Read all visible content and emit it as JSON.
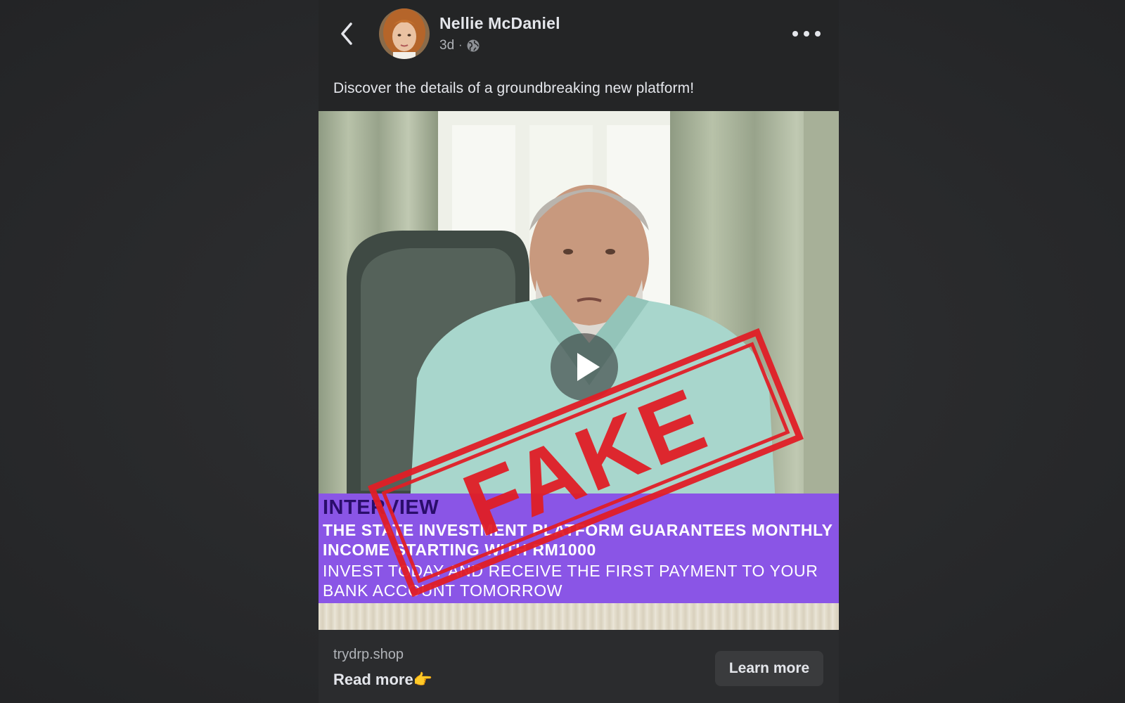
{
  "post": {
    "author_name": "Nellie McDaniel",
    "age": "3d",
    "separator": "·",
    "audience_icon": "globe-icon",
    "caption": "Discover the details of a groundbreaking new platform!"
  },
  "video": {
    "banner_line1": "INTERVIEW",
    "banner_line2": "THE STATE INVESTMENT PLATFORM GUARANTEES MONTHLY INCOME STARTING WITH RM1000",
    "banner_line3": "INVEST TODAY AND RECEIVE THE FIRST PAYMENT TO YOUR BANK ACCOUNT TOMORROW",
    "stamp_text": "FAKE",
    "stamp_color": "#e01e26",
    "banner_color": "#8a55e6"
  },
  "link": {
    "domain": "trydrp.shop",
    "headline": "Read more👉",
    "cta_label": "Learn more"
  },
  "icons": {
    "back": "chevron-left-icon",
    "more": "more-horizontal-icon",
    "play": "play-icon"
  }
}
